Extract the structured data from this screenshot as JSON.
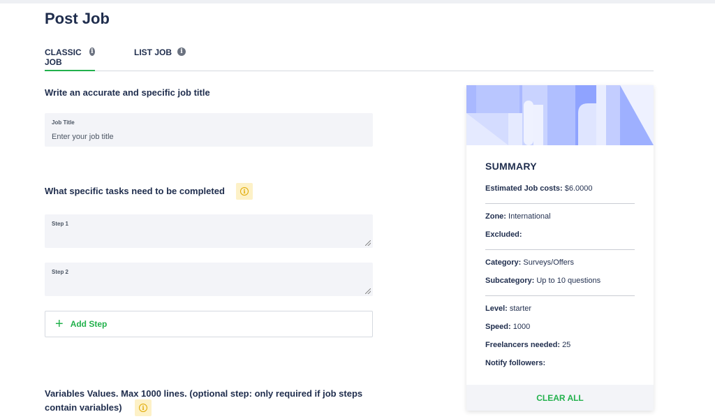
{
  "page": {
    "title": "Post Job"
  },
  "tabs": [
    {
      "label": "CLASSIC JOB",
      "active": true
    },
    {
      "label": "LIST JOB",
      "active": false
    }
  ],
  "job_title_section": {
    "heading": "Write an accurate and specific job title",
    "field_label": "Job Title",
    "placeholder": "Enter your job title"
  },
  "tasks_section": {
    "heading": "What specific tasks need to be completed",
    "steps": [
      {
        "label": "Step 1"
      },
      {
        "label": "Step 2"
      }
    ],
    "add_step_label": "Add Step"
  },
  "variables_section": {
    "heading_line1": "Variables Values. Max 1000 lines. (optional step: only required if job steps",
    "heading_line2": "contain variables)"
  },
  "summary": {
    "title": "SUMMARY",
    "estimated_cost_label": "Estimated Job costs:",
    "estimated_cost_value": "$6.0000",
    "zone_label": "Zone:",
    "zone_value": "International",
    "excluded_label": "Excluded:",
    "excluded_value": "",
    "category_label": "Category:",
    "category_value": "Surveys/Offers",
    "subcategory_label": "Subcategory:",
    "subcategory_value": "Up to 10 questions",
    "level_label": "Level:",
    "level_value": "starter",
    "speed_label": "Speed:",
    "speed_value": "1000",
    "freelancers_label": "Freelancers needed:",
    "freelancers_value": "25",
    "notify_label": "Notify followers:",
    "notify_value": "",
    "clear_all_label": "CLEAR ALL"
  },
  "colors": {
    "accent": "#22b14c",
    "text": "#1f2d4d",
    "field_bg": "#f3f4f8",
    "warn_bg": "#fdf1c7",
    "warn": "#e0a800"
  },
  "icons": {
    "tab_info": "info-circle-icon",
    "task_warning": "info-circle-icon",
    "add_step": "plus-icon"
  }
}
